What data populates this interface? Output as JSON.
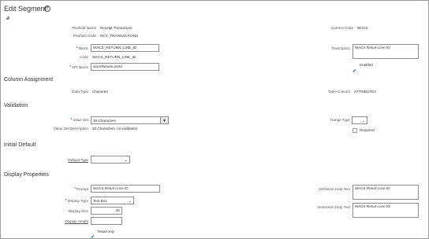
{
  "header": {
    "title": "Edit Segment",
    "help_icon": "?"
  },
  "segment": {
    "flexfield_name_label": "Flexfield Name",
    "flexfield_name": "Receipt Transaction",
    "flexfield_code_label": "Flexfield Code",
    "flexfield_code": "RCV_TRANSACTIONS",
    "context_code_label": "Context Code",
    "context_code": "WACS",
    "name_label": "Name",
    "name": "WACS_RETURN_LINE_ID",
    "code_label": "Code",
    "code": "WACS_RETURN_LINE_ID",
    "api_name_label": "API Name",
    "api_name": "wacsReturnLineId",
    "description_label": "Description",
    "description": "WACS Return Line ID",
    "enabled_label": "Enabled",
    "enabled": true
  },
  "column_assignment": {
    "heading": "Column Assignment",
    "data_type_label": "Data Type",
    "data_type": "Character",
    "table_column_label": "Table Column",
    "table_column": "ATTRIBUTE3"
  },
  "validation": {
    "heading": "Validation",
    "value_set_label": "Value Set",
    "value_set": "30 Characters",
    "value_set_description_label": "Value Set Description",
    "value_set_description": "30 Characters, no validation",
    "range_type_label": "Range Type",
    "range_type": "",
    "required_label": "Required",
    "required": false
  },
  "initial_default": {
    "heading": "Initial Default",
    "default_type_label": "Default Type",
    "default_type": ""
  },
  "display_properties": {
    "heading": "Display Properties",
    "prompt_label": "Prompt",
    "prompt": "WACS Return Line ID",
    "display_type_label": "Display Type",
    "display_type": "Text Box",
    "display_size_label": "Display Size",
    "display_size": "25",
    "display_height_label": "Display Height",
    "display_height": "",
    "read_only_label": "Read-only",
    "read_only": true,
    "definition_help_text_label": "Definition Help Text",
    "definition_help_text": "WACS Return Line ID",
    "instruction_help_text_label": "Instruction Help Text",
    "instruction_help_text": "WACS Return Line ID"
  },
  "colors": {
    "required": "#c00000",
    "check": "#2b7bd3",
    "border": "#8c8c8c"
  }
}
